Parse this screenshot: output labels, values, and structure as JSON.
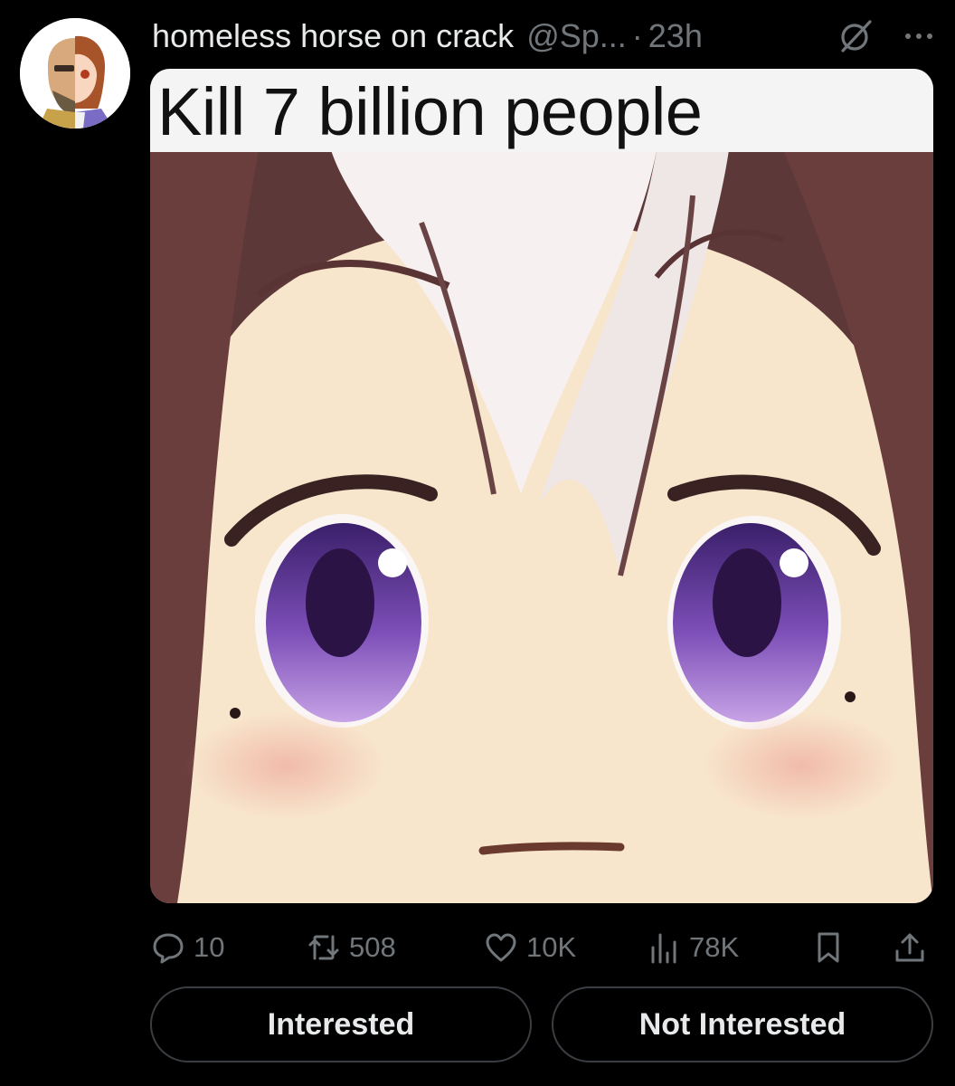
{
  "tweet": {
    "display_name": "homeless horse on crack",
    "handle": "@Sp...",
    "separator": "·",
    "time": "23h",
    "media_caption": "Kill 7 billion people"
  },
  "actions": {
    "replies": "10",
    "retweets": "508",
    "likes": "10K",
    "views": "78K"
  },
  "buttons": {
    "interested": "Interested",
    "not_interested": "Not Interested"
  },
  "icons": [
    "avatar",
    "grok-icon",
    "more-icon",
    "reply-icon",
    "retweet-icon",
    "like-icon",
    "views-icon",
    "bookmark-icon",
    "share-icon"
  ],
  "colors": {
    "background": "#000000",
    "text": "#e7e9ea",
    "muted": "#71767b",
    "eye": "#7d4fb8"
  }
}
